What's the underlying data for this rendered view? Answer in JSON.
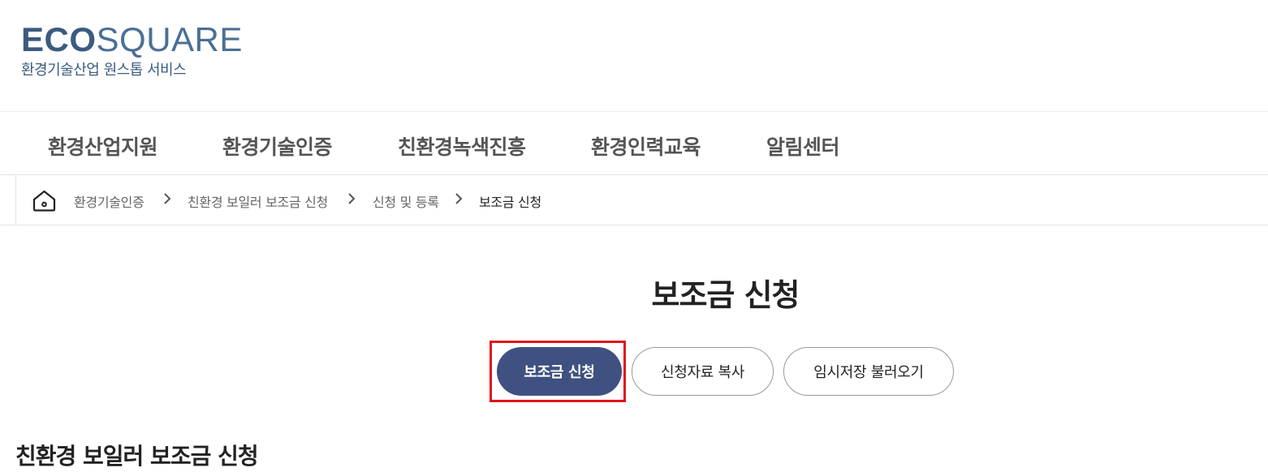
{
  "logo": {
    "eco": "ECO",
    "square": "SQUARE",
    "tagline": "환경기술산업 원스톱 서비스"
  },
  "gnb": {
    "items": [
      "환경산업지원",
      "환경기술인증",
      "친환경녹색진흥",
      "환경인력교육",
      "알림센터"
    ]
  },
  "breadcrumb": {
    "home_icon": "home-icon",
    "separator_icon": "chevron-right-icon",
    "items": [
      "환경기술인증",
      "친환경 보일러 보조금 신청",
      "신청 및 등록",
      "보조금 신청"
    ]
  },
  "page": {
    "title": "보조금 신청",
    "section_title": "친환경 보일러 보조금 신청"
  },
  "actions": {
    "apply": "보조금 신청",
    "copy": "신청자료 복사",
    "load_draft": "임시저장 불러오기"
  },
  "colors": {
    "brand": "#3c5b80",
    "primary_button": "#3f5181",
    "highlight_box": "#e0141e"
  }
}
